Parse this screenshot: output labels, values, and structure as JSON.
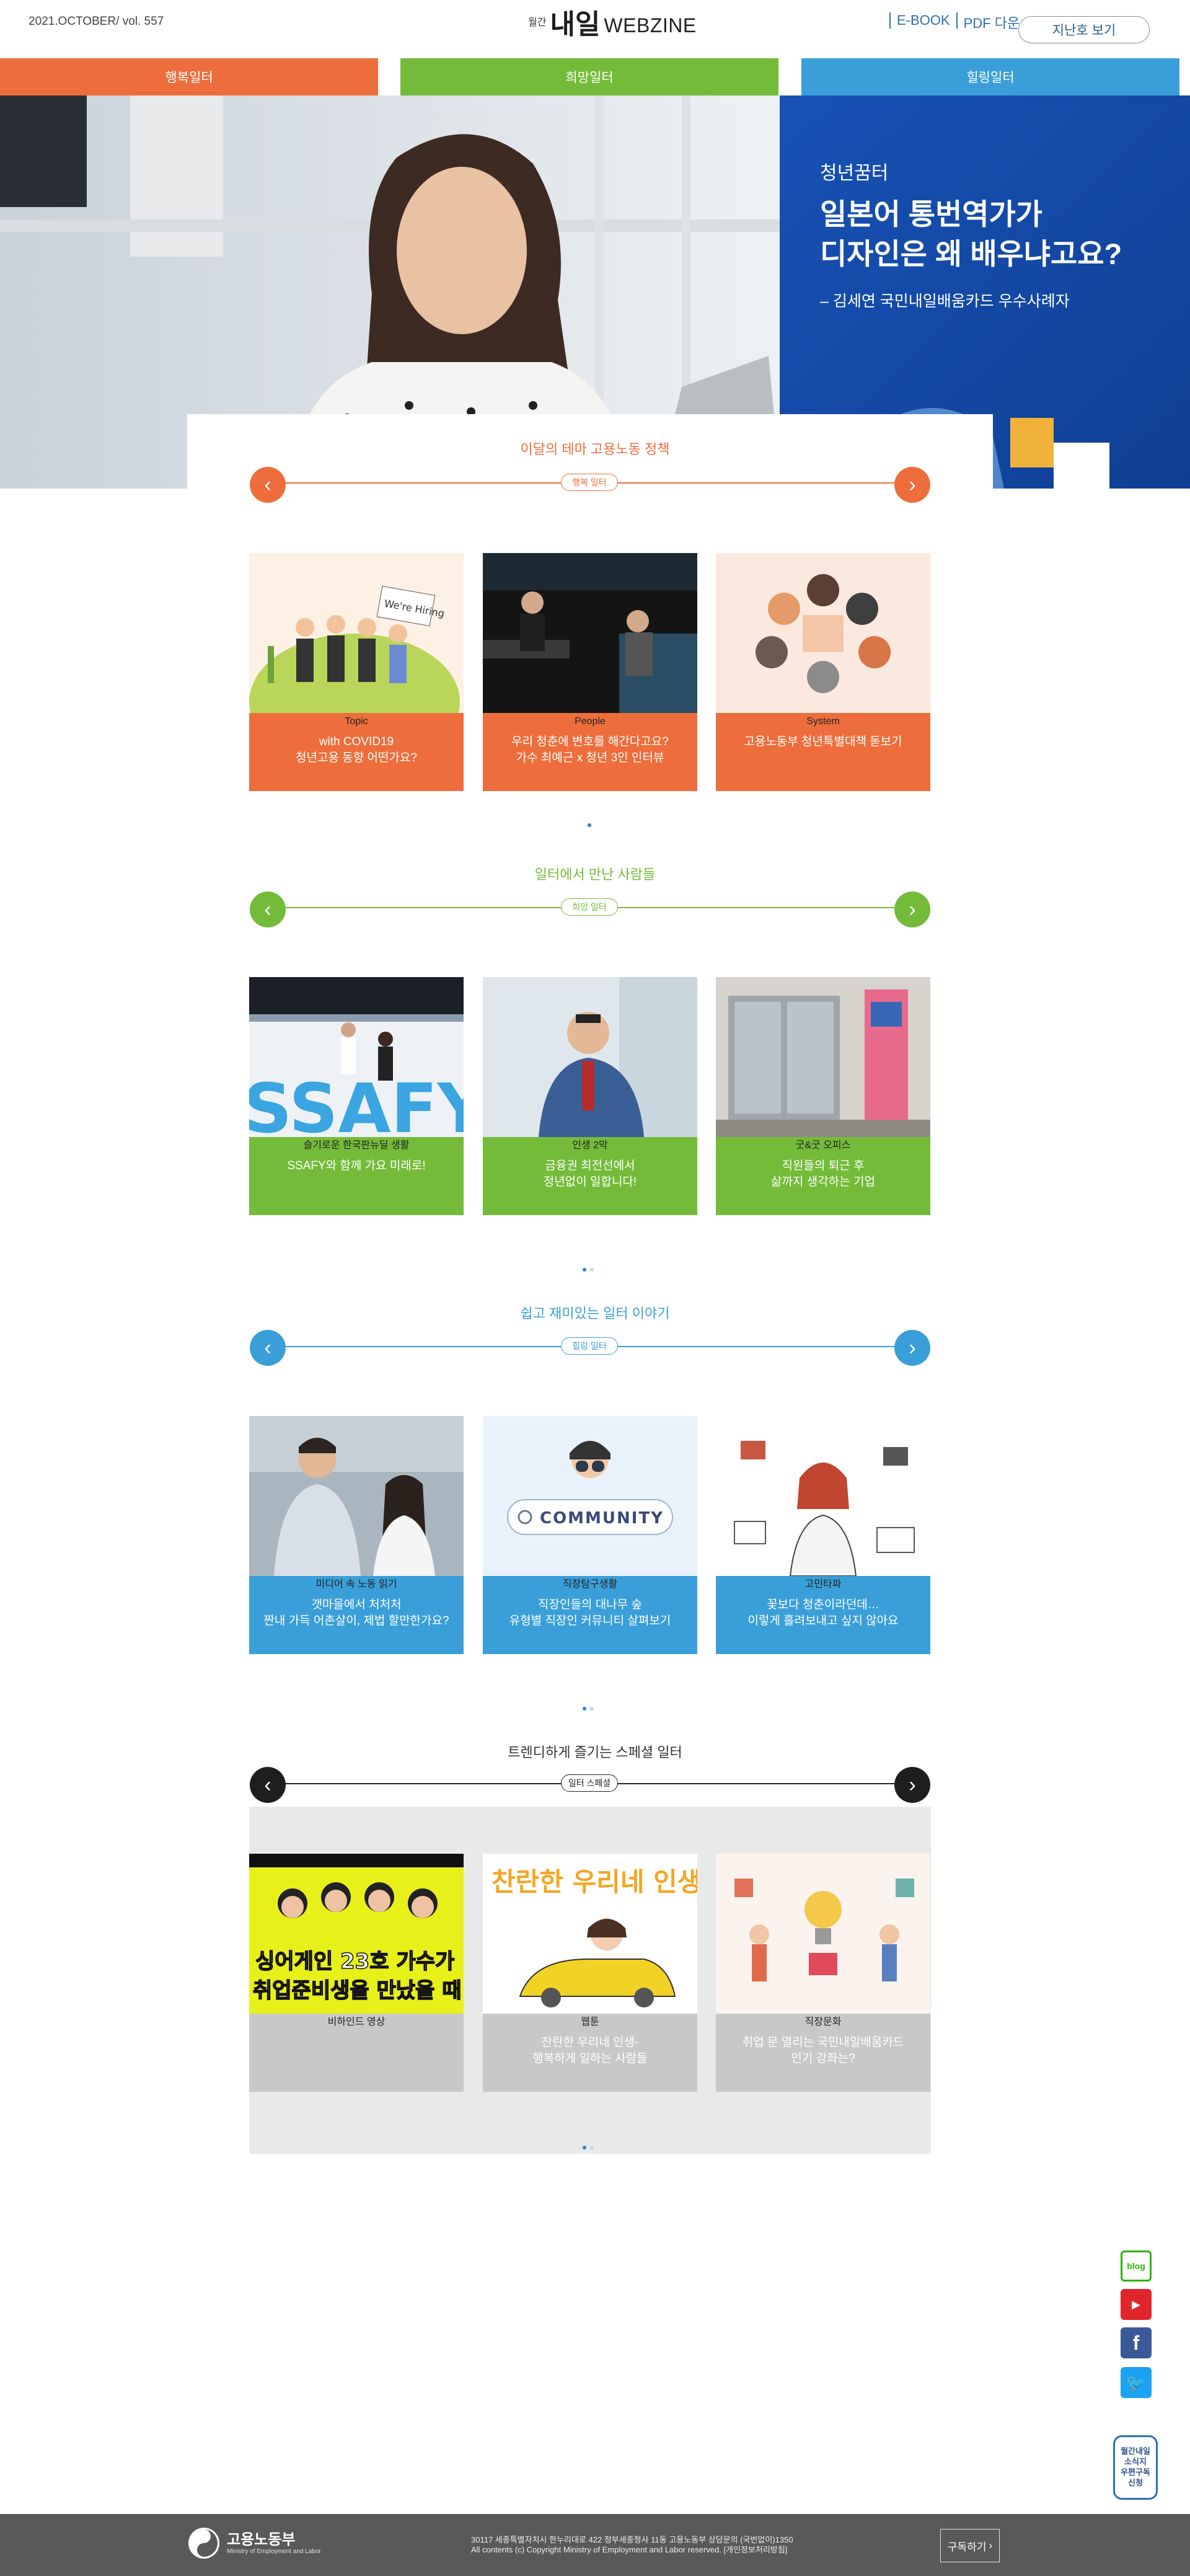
{
  "header": {
    "issue": "2021.OCTOBER/ vol. 557",
    "logo_small": "월간",
    "logo_main": "내일",
    "logo_web": "WEBZINE",
    "ebook": "E-BOOK",
    "pdf": "PDF 다운",
    "past_issue": "지난호 보기"
  },
  "nav": [
    "행복일터",
    "희망일터",
    "힐링일터"
  ],
  "hero": {
    "category": "청년꿈터",
    "title_line1": "일본어 통번역가가",
    "title_line2": "디자인은 왜 배우냐고요?",
    "subtitle": "– 김세연 국민내일배움카드 우수사례자"
  },
  "sections": [
    {
      "title": "이달의 테마 고용노동 정책",
      "badge": "행복 일터",
      "color": "#ed6e3c",
      "cards": [
        {
          "category": "Topic",
          "title_line1": "with COVID19",
          "title_line2": "청년고용 동향 어떤가요?"
        },
        {
          "category": "People",
          "title_line1": "우리 청춘에 변호를 해간다고요?",
          "title_line2": "가수 최예근 x 청년 3인 인터뷰"
        },
        {
          "category": "System",
          "title_line1": "고용노동부 청년특별대책 돋보기",
          "title_line2": ""
        }
      ]
    },
    {
      "title": "일터에서 만난 사람들",
      "badge": "희망 일터",
      "color": "#74bb3a",
      "cards": [
        {
          "category": "슬기로운 한국판뉴딜 생활",
          "title_line1": "SSAFY와 함께 가요 미래로!",
          "title_line2": ""
        },
        {
          "category": "인생 2막",
          "title_line1": "금융권 최전선에서",
          "title_line2": "정년없이 일합니다!"
        },
        {
          "category": "굿&굿 오피스",
          "title_line1": "직원들의 퇴근 후",
          "title_line2": "삶까지 생각하는 기업"
        }
      ]
    },
    {
      "title": "쉽고 재미있는 일터 이야기",
      "badge": "힐링 일터",
      "color": "#3a9fd9",
      "cards": [
        {
          "category": "미디어 속 노동 읽기",
          "title_line1": "갯마을에서 처처처",
          "title_line2": "짠내 가득 어촌살이, 제법 할만한가요?"
        },
        {
          "category": "직장탐구생활",
          "title_line1": "직장인들의 대나무 숲",
          "title_line2": "유형별 직장인 커뮤니티 살펴보기"
        },
        {
          "category": "고민타파",
          "title_line1": "꽃보다 청춘이라던데…",
          "title_line2": "이렇게 흘려보내고 싶지 않아요"
        }
      ]
    },
    {
      "title": "트렌디하게 즐기는 스페셜 일터",
      "badge": "일터 스페셜",
      "color": "#222222",
      "cards": [
        {
          "category": "비하인드 영상",
          "title_line1": "",
          "title_line2": ""
        },
        {
          "category": "웹툰",
          "title_line1": "찬란한 우리네 인생-",
          "title_line2": "행복하게 일하는 사람들"
        },
        {
          "category": "직장문화",
          "title_line1": "취업 문 열리는 국민내일배움카드",
          "title_line2": "인기 강좌는?"
        }
      ]
    }
  ],
  "card_images": {
    "community_text": "COMMUNITY",
    "ssafy_text": "SSAFY",
    "webtoon_title": "찬란한 우리네 인생",
    "video_caption_1": "싱어게인 23호 가수가",
    "video_caption_2": "취업준비생을 만났을 때",
    "topic_sign": "We're Hiring"
  },
  "side": {
    "blog": "blog",
    "subscribe_line1": "월간내일",
    "subscribe_line2": "소식지",
    "subscribe_line3": "우편구독",
    "subscribe_line4": "신청"
  },
  "footer": {
    "ministry": "고용노동부",
    "ministry_eng": "Ministry of Employment and Labor",
    "address": "30117 세종특별자치시 한누리대로 422 정부세종청사 11동 고용노동부 상담문의 (국번없이)1350",
    "copyright": "All contents (c) Copyright Ministry of Employment and Labor reserved. [개인정보처리방침]",
    "subscribe": "구독하기"
  }
}
